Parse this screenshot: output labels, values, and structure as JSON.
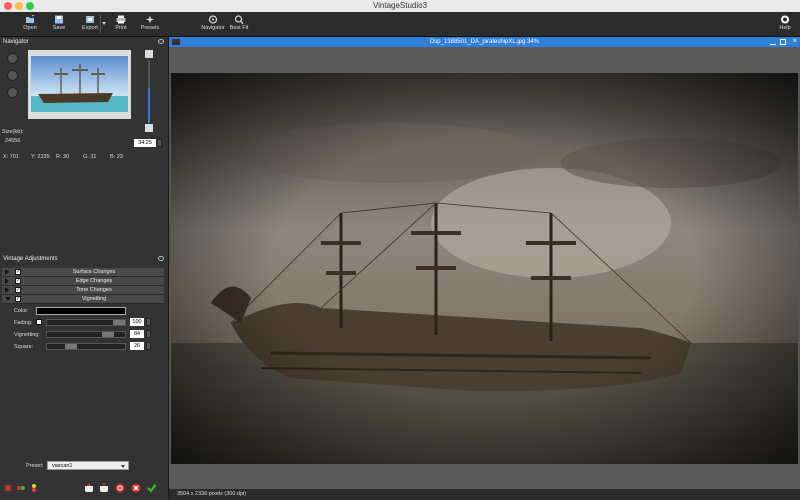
{
  "app": {
    "title": "VintageStudio3"
  },
  "toolbar": {
    "items": [
      {
        "label": "Open",
        "icon": "open-icon"
      },
      {
        "label": "Save",
        "icon": "save-icon"
      },
      {
        "label": "Export",
        "icon": "export-icon"
      },
      {
        "label": "Print",
        "icon": "print-icon"
      },
      {
        "label": "Presets",
        "icon": "presets-icon"
      },
      {
        "label": "Navigator",
        "icon": "navigator-icon"
      },
      {
        "label": "Best Fit",
        "icon": "best-fit-icon"
      },
      {
        "label": "Help",
        "icon": "help-icon"
      }
    ]
  },
  "navigator": {
    "header": "Navigator",
    "size_label": "Size(kb):",
    "size_value": "24556",
    "zoom_value": "34.25",
    "coords": {
      "x": "X: 701",
      "y": "Y: 2335",
      "r": "R: 30",
      "g": "G: 31",
      "b": "B: 23"
    }
  },
  "adjustments": {
    "header": "Vintage Adjustments",
    "sections": [
      {
        "label": "Surface Changes",
        "expanded": false,
        "checked": true
      },
      {
        "label": "Edge Changes",
        "expanded": false,
        "checked": true
      },
      {
        "label": "Tone Changes",
        "expanded": false,
        "checked": true
      },
      {
        "label": "Vignetting",
        "expanded": true,
        "checked": true
      }
    ],
    "color_label": "Color:",
    "color_value": "#000000",
    "fading": {
      "label": "Fading:",
      "value": "100",
      "fraction": 1.0
    },
    "vignetting": {
      "label": "Vignetting:",
      "value": "84",
      "fraction": 0.84
    },
    "square": {
      "label": "Square:",
      "value": "26",
      "fraction": 0.26
    }
  },
  "preset": {
    "label": "Preset:",
    "value": "vascan1"
  },
  "document": {
    "title": "Dsp_1388501_DA_pirateshipXL.jpg 34%",
    "status": "3504 x 2336 pixels (300 dpi)"
  },
  "colors": {
    "accent": "#2f7fd8",
    "panel": "#333333",
    "toolbar": "#2c2c2c"
  }
}
